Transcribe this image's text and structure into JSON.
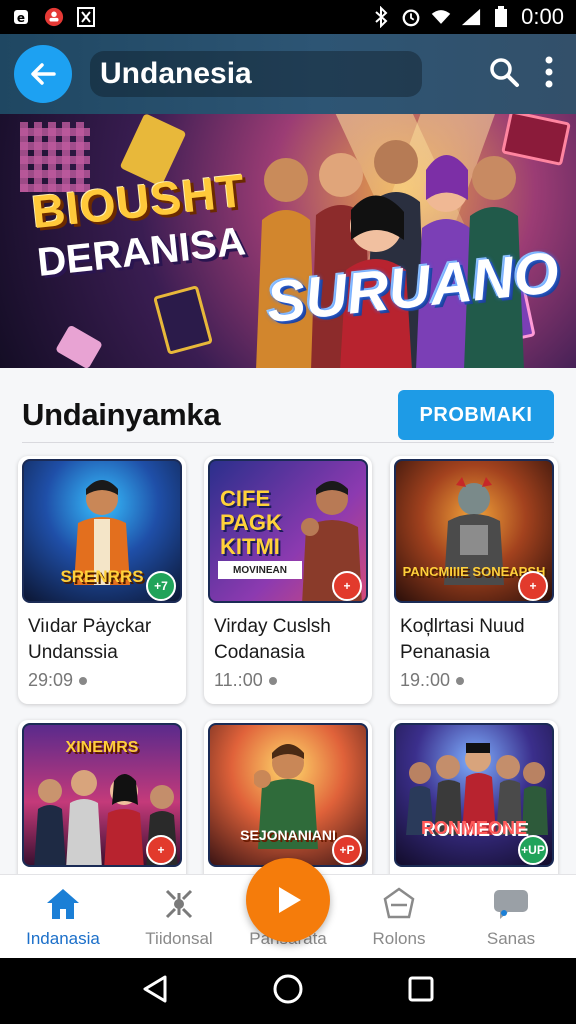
{
  "status_bar": {
    "time": "0:00",
    "icons": [
      "notification-e-icon",
      "record-icon",
      "screenshot-icon",
      "bluetooth-icon",
      "alarm-icon",
      "wifi-icon",
      "signal-icon",
      "battery-icon"
    ]
  },
  "app_bar": {
    "title": "Undanesia",
    "back_icon": "arrow-left-icon",
    "actions": [
      "search-icon",
      "more-vert-icon"
    ],
    "accent": "#1da1f2"
  },
  "banner": {
    "headline_1": "BIOUSHT",
    "headline_2": "DERANISA",
    "logo": "SURUANO"
  },
  "section": {
    "title": "Undainyamka",
    "button_label": "PROBMAKI",
    "button_color": "#1e9be6"
  },
  "cards": [
    {
      "thumb_title": "SRENRRS",
      "name": "Viıdar Pȧyckar Undanssia",
      "meta": "29:09",
      "badge": "+7",
      "badge_color": "#21a35a"
    },
    {
      "thumb_title": "CIFE PAGK KITMI",
      "thumb_sub": "MOVINEAN",
      "name": "Virday Cuslsh Codanasia",
      "meta": "11.:00",
      "badge": "+",
      "badge_color": "#e23a2c"
    },
    {
      "thumb_title": "PANCMIIIE SONEAPSH",
      "name": "Koḑlrtasi Nuud Penanasia",
      "meta": "19.:00",
      "badge": "+",
      "badge_color": "#e23a2c"
    },
    {
      "thumb_title": "XINEMRS",
      "badge": "+",
      "badge_color": "#e23a2c"
    },
    {
      "thumb_title": "SEJONANIANI",
      "badge": "+P",
      "badge_color": "#e23a2c"
    },
    {
      "thumb_title": "RONMEONE",
      "badge": "+UP",
      "badge_color": "#21a35a"
    }
  ],
  "bottom_nav": {
    "items": [
      {
        "label": "Indanasia",
        "icon": "home-icon",
        "active": true
      },
      {
        "label": "Tiidonsal",
        "icon": "sparkle-icon",
        "active": false
      },
      {
        "label": "Pansarata",
        "icon": "play-icon",
        "active": false
      },
      {
        "label": "Rolons",
        "icon": "badge-icon",
        "active": false
      },
      {
        "label": "Sanas",
        "icon": "chat-icon",
        "active": false
      }
    ],
    "fab_color": "#f57c0b"
  },
  "system_nav": [
    "back-triangle-icon",
    "home-circle-icon",
    "recents-square-icon"
  ]
}
